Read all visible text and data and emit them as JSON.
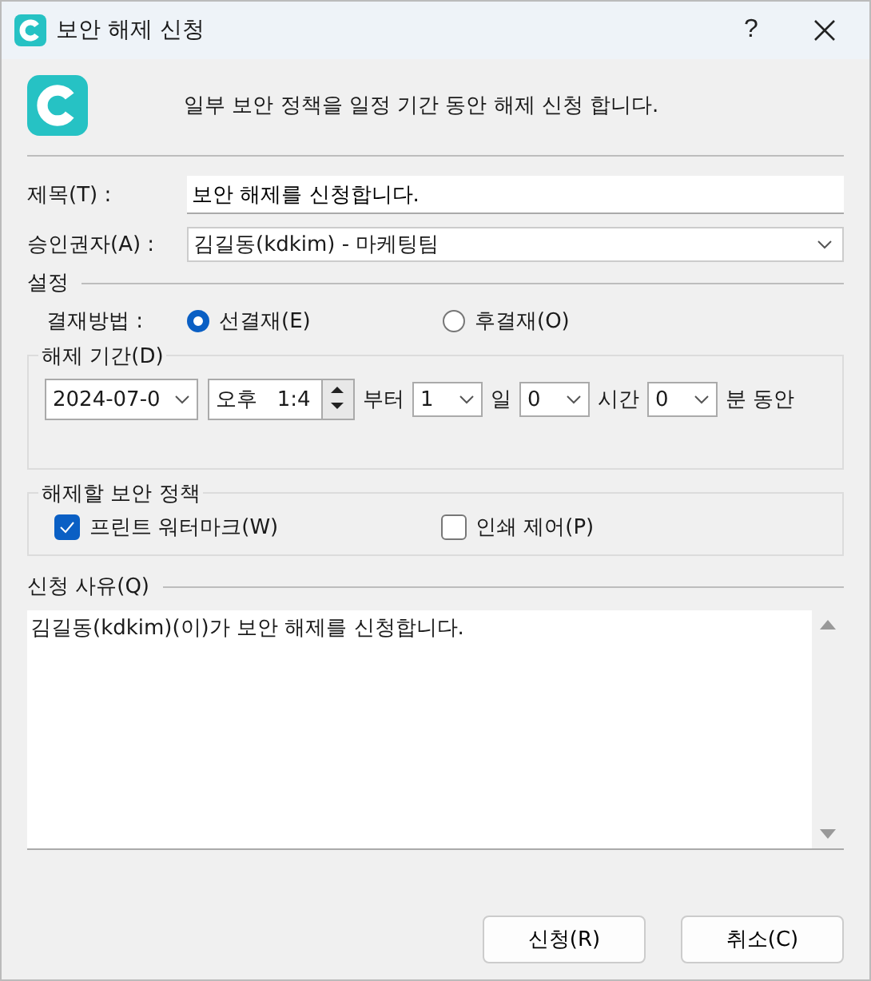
{
  "window": {
    "title": "보안 해제 신청",
    "help": "?"
  },
  "description": "일부 보안 정책을 일정 기간 동안 해제 신청 합니다.",
  "subject": {
    "label": "제목(T) :",
    "value": "보안 해제를 신청합니다."
  },
  "approver": {
    "label": "승인권자(A) :",
    "value": "김길동(kdkim) - 마케팅팀"
  },
  "settings": {
    "title": "설정",
    "method_label": "결재방법 :",
    "methods": [
      {
        "label": "선결재(E)",
        "selected": true
      },
      {
        "label": "후결재(O)",
        "selected": false
      }
    ]
  },
  "period": {
    "title": "해제 기간(D)",
    "date": "2024-07-0",
    "time_ampm": "오후",
    "time": "1:4",
    "from_label": "부터",
    "days": "1",
    "days_label": "일",
    "hours": "0",
    "hours_label": "시간",
    "minutes": "0",
    "minutes_label": "분 동안"
  },
  "policies": {
    "title": "해제할 보안 정책",
    "items": [
      {
        "label": "프린트 워터마크(W)",
        "checked": true
      },
      {
        "label": "인쇄 제어(P)",
        "checked": false
      }
    ]
  },
  "reason": {
    "title": "신청 사유(Q)",
    "value": "김길동(kdkim)(이)가 보안 해제를 신청합니다."
  },
  "buttons": [
    "신청(R)",
    "취소(C)"
  ]
}
